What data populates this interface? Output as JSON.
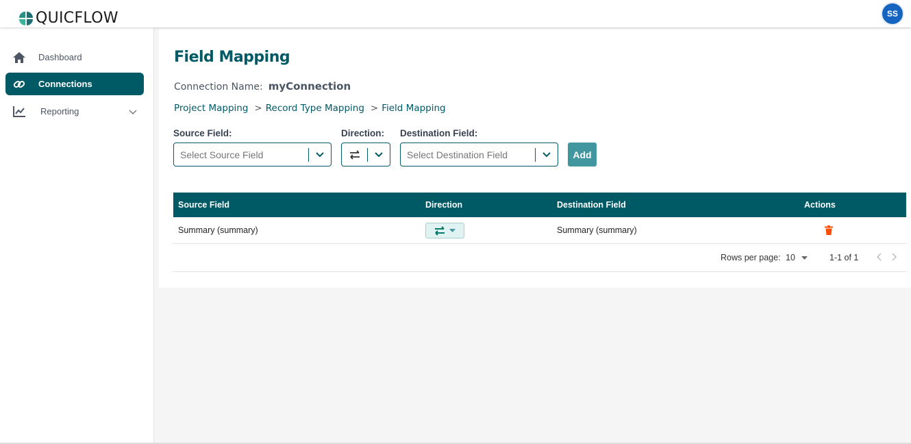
{
  "app": {
    "brand": "QUICFLOW",
    "user_initials": "SS"
  },
  "sidebar": {
    "items": [
      {
        "label": "Dashboard",
        "icon": "home-icon"
      },
      {
        "label": "Connections",
        "icon": "link-icon",
        "active": true
      },
      {
        "label": "Reporting",
        "icon": "chart-line-icon",
        "expandable": true
      }
    ]
  },
  "page": {
    "title": "Field Mapping",
    "connection_label": "Connection Name:",
    "connection_value": "myConnection",
    "breadcrumbs": [
      "Project Mapping",
      "Record Type Mapping",
      "Field Mapping"
    ],
    "breadcrumb_sep": ">"
  },
  "form": {
    "source_label": "Source Field:",
    "source_placeholder": "Select Source Field",
    "direction_label": "Direction:",
    "destination_label": "Destination Field:",
    "destination_placeholder": "Select Destination Field",
    "add_label": "Add"
  },
  "table": {
    "headers": [
      "Source Field",
      "Direction",
      "Destination Field",
      "Actions"
    ],
    "rows": [
      {
        "source": "Summary (summary)",
        "direction": "bidirectional",
        "destination": "Summary (summary)"
      }
    ],
    "pagination": {
      "rows_per_page_label": "Rows per page:",
      "rows_per_page": "10",
      "range": "1-1 of 1"
    }
  },
  "colors": {
    "primary": "#005a66",
    "add_button": "#4196a0",
    "delete": "#ff4d00",
    "avatar": "#1565c0"
  }
}
